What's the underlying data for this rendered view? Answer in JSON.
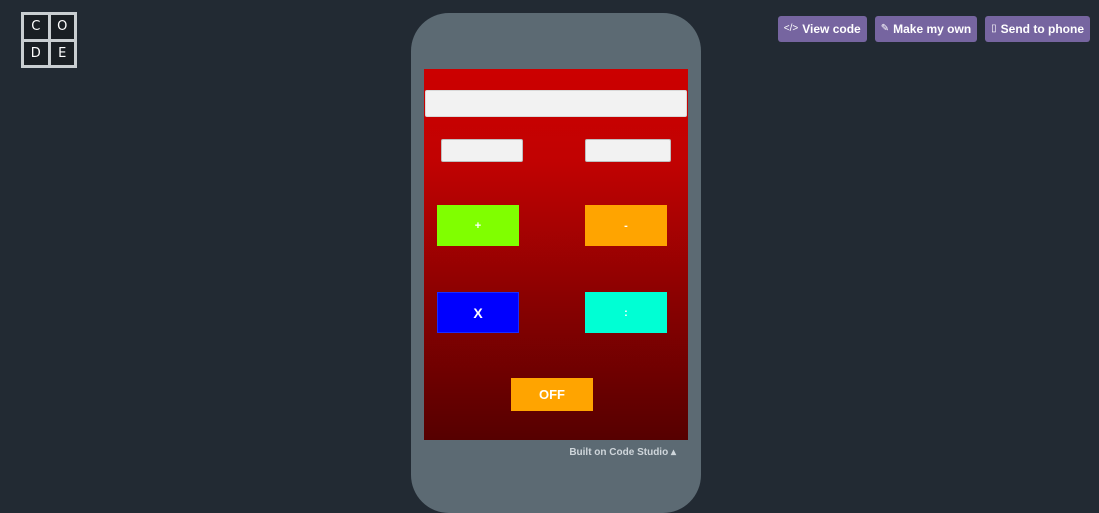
{
  "logo": {
    "letters": [
      "C",
      "O",
      "D",
      "E"
    ]
  },
  "header": {
    "view_code": {
      "icon": "</>",
      "label": "View code"
    },
    "make_my_own": {
      "icon": "✎",
      "label": "Make my own"
    },
    "send_to_phone": {
      "icon": "▯",
      "label": "Send to phone"
    }
  },
  "app": {
    "display_value": "",
    "first_number_value": "",
    "second_number_value": "",
    "buttons": {
      "plus": "+",
      "minus": "-",
      "multiply": "X",
      "divide": ":",
      "off": "OFF"
    },
    "colors": {
      "plus": "#80ff00",
      "minus": "#ffa400",
      "multiply": "#0000ff",
      "divide": "#00ffd4",
      "off": "#ffa400",
      "background_top": "#cc0000",
      "background_bottom": "#560000"
    }
  },
  "footer": {
    "label": "Built on Code Studio",
    "icon": "▴"
  }
}
